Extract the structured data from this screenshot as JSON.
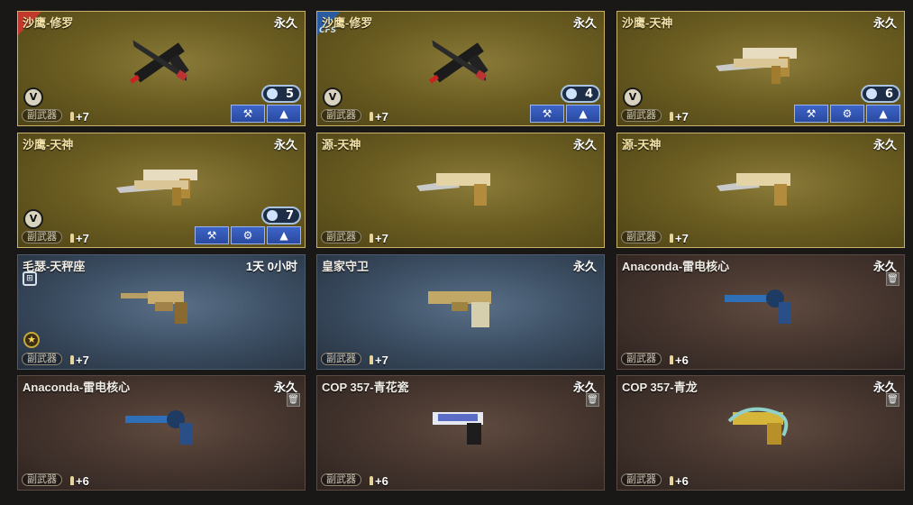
{
  "cards": [
    {
      "name": "沙鹰-修罗",
      "duration": "永久",
      "category": "副武器",
      "level": "+7",
      "count": "5",
      "weapon": "desert-eagle-shura"
    },
    {
      "name": "沙鹰-修罗",
      "duration": "永久",
      "category": "副武器",
      "level": "+7",
      "count": "4",
      "weapon": "desert-eagle-shura",
      "corner_text": "CFS"
    },
    {
      "name": "沙鹰-天神",
      "duration": "永久",
      "category": "副武器",
      "level": "+7",
      "count": "6",
      "weapon": "desert-eagle-god"
    },
    {
      "name": "沙鹰-天神",
      "duration": "永久",
      "category": "副武器",
      "level": "+7",
      "count": "7",
      "weapon": "desert-eagle-god"
    },
    {
      "name": "源-天神",
      "duration": "永久",
      "category": "副武器",
      "level": "+7",
      "weapon": "desert-eagle-god-origin"
    },
    {
      "name": "源-天神",
      "duration": "永久",
      "category": "副武器",
      "level": "+7",
      "weapon": "desert-eagle-god-origin"
    },
    {
      "name": "毛瑟-天秤座",
      "duration": "1天 0小时",
      "category": "副武器",
      "level": "+7",
      "weapon": "mauser-libra"
    },
    {
      "name": "皇家守卫",
      "duration": "永久",
      "category": "副武器",
      "level": "+7",
      "weapon": "royal-guard"
    },
    {
      "name": "Anaconda-雷电核心",
      "duration": "永久",
      "category": "副武器",
      "level": "+6",
      "weapon": "anaconda-thunder-core"
    },
    {
      "name": "Anaconda-雷电核心",
      "duration": "永久",
      "category": "副武器",
      "level": "+6",
      "weapon": "anaconda-thunder-core"
    },
    {
      "name": "COP 357-青花瓷",
      "duration": "永久",
      "category": "副武器",
      "level": "+6",
      "weapon": "cop357-porcelain"
    },
    {
      "name": "COP 357-青龙",
      "duration": "永久",
      "category": "副武器",
      "level": "+6",
      "weapon": "cop357-dragon"
    }
  ],
  "icons": {
    "v_badge": "V",
    "upgrade": "arrow-up-icon",
    "settings": "gear-icon",
    "tools": "wrench-gear-icon",
    "trash": "trash-icon"
  },
  "colors": {
    "gold_border": "#c9b36a",
    "button_blue": "#3d64c8",
    "pill_border": "#a9c2e0"
  }
}
